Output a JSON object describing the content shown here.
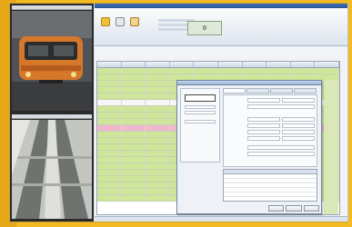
{
  "app": {
    "title": ""
  },
  "ribbon": {
    "buttons": [
      {
        "icon": "camera-icon",
        "label": ""
      },
      {
        "icon": "document-icon",
        "label": ""
      },
      {
        "icon": "folder-icon",
        "label": ""
      }
    ],
    "counter_value": "0"
  },
  "grid": {
    "columns": [
      "",
      "",
      "",
      "",
      "",
      "",
      "",
      "",
      "",
      ""
    ],
    "row_colors": [
      "green",
      "green",
      "green",
      "green",
      "green",
      "white",
      "green",
      "green",
      "green",
      "pink",
      "green",
      "green",
      "green",
      "green",
      "green",
      "green",
      "green",
      "green",
      "green",
      "green",
      "green"
    ]
  },
  "dialog": {
    "title": "",
    "tabs": [
      "",
      "",
      "",
      ""
    ]
  },
  "colors": {
    "frame": "#f4ba22",
    "row_ok": "#cfe69a",
    "row_alert": "#f0b6cf",
    "titlebar": "#2d5596"
  }
}
